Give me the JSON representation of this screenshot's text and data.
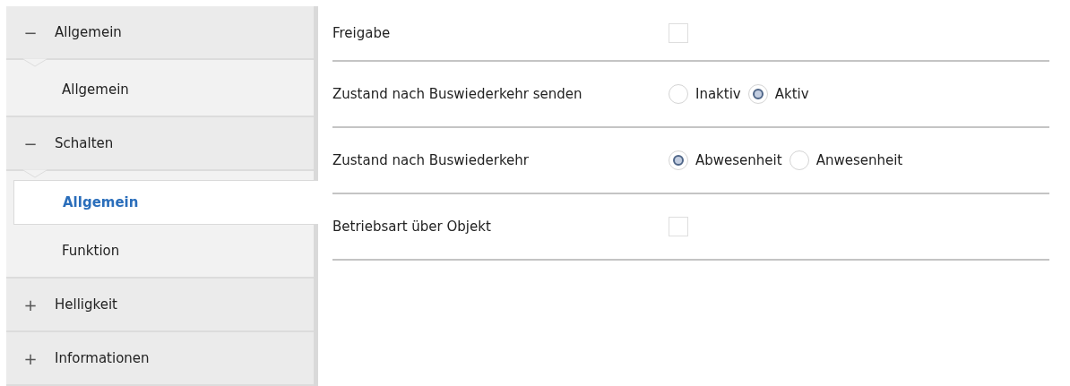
{
  "sidebar": {
    "groups": [
      {
        "icon": "−",
        "label": "Allgemein",
        "expanded": true,
        "children": [
          {
            "label": "Allgemein",
            "selected": false
          }
        ]
      },
      {
        "icon": "−",
        "label": "Schalten",
        "expanded": true,
        "children": [
          {
            "label": "Allgemein",
            "selected": true
          },
          {
            "label": "Funktion",
            "selected": false
          }
        ]
      },
      {
        "icon": "+",
        "label": "Helligkeit",
        "expanded": false
      },
      {
        "icon": "+",
        "label": "Informationen",
        "expanded": false
      }
    ]
  },
  "parameters": [
    {
      "kind": "checkbox",
      "label": "Freigabe",
      "checked": false
    },
    {
      "kind": "radio",
      "label": "Zustand nach Buswiederkehr senden",
      "options": [
        {
          "label": "Inaktiv",
          "selected": false
        },
        {
          "label": "Aktiv",
          "selected": true
        }
      ]
    },
    {
      "kind": "radio",
      "label": "Zustand nach Buswiederkehr",
      "options": [
        {
          "label": "Abwesenheit",
          "selected": true
        },
        {
          "label": "Anwesenheit",
          "selected": false
        }
      ]
    },
    {
      "kind": "checkbox",
      "label": "Betriebsart über Objekt",
      "checked": false
    }
  ]
}
